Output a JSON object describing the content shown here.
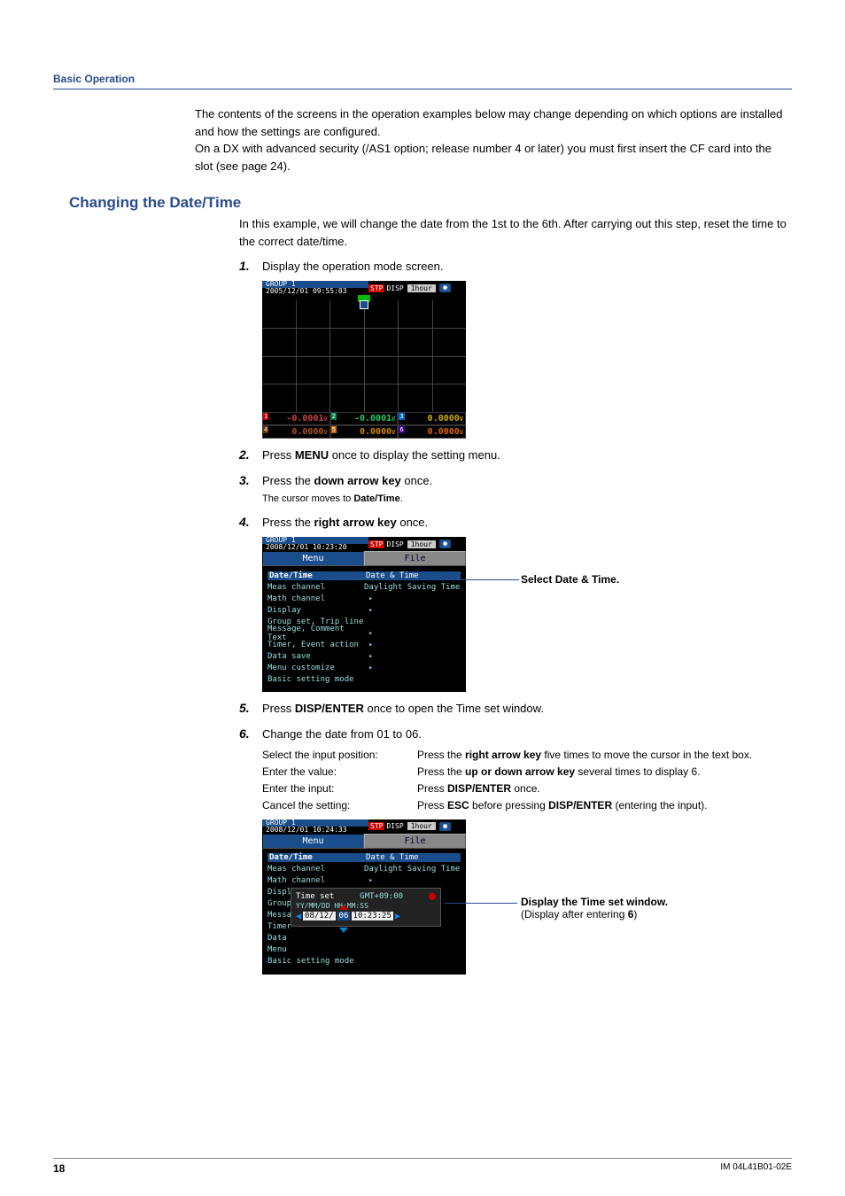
{
  "header": {
    "title": "Basic Operation"
  },
  "intro": {
    "p1": "The contents of the screens in the operation examples below may change depending on which options are installed and how the settings are configured.",
    "p2a": "On a DX with advanced security (/AS1 option; release number 4 or later) you must first insert the CF card into the slot (see page 24)."
  },
  "section": {
    "title": "Changing the Date/Time"
  },
  "lead": "In this example, we will change the date from the 1st to the 6th. After carrying out this step, reset the time to the correct date/time.",
  "steps": {
    "s1": {
      "n": "1.",
      "text": "Display the operation mode screen."
    },
    "s2": {
      "n": "2.",
      "pre": "Press ",
      "b": "MENU",
      "post": " once to display the setting menu."
    },
    "s3": {
      "n": "3.",
      "pre": "Press the ",
      "b": "down arrow key",
      "post": " once.",
      "note_pre": "The cursor moves to ",
      "note_b": "Date/Time",
      "note_post": "."
    },
    "s4": {
      "n": "4.",
      "pre": "Press the ",
      "b": "right arrow key",
      "post": " once."
    },
    "s5": {
      "n": "5.",
      "pre": "Press ",
      "b": "DISP/ENTER",
      "post": " once to open the Time set window."
    },
    "s6": {
      "n": "6.",
      "text": "Change the date from 01 to 06."
    }
  },
  "inputs": {
    "r1": {
      "label": "Select the input position:",
      "d1": "Press the ",
      "b": "right arrow key",
      "d2": " five times to move the cursor in the text box."
    },
    "r2": {
      "label": "Enter the value:",
      "d1": "Press the ",
      "b": "up or down arrow key",
      "d2": " several times to display 6."
    },
    "r3": {
      "label": "Enter the input:",
      "d1": "Press ",
      "b": "DISP/ENTER",
      "d2": " once."
    },
    "r4": {
      "label": "Cancel the setting:",
      "d1": "Press ",
      "b": "ESC",
      "d2": " before pressing ",
      "b2": "DISP/ENTER",
      "d3": " (entering the input)."
    }
  },
  "shot1": {
    "group": "GROUP 1",
    "datetime": "2005/12/01 09:55:03",
    "badge": "STP",
    "disp": "DISP",
    "span": "1hour",
    "cam": "◉",
    "r1": {
      "t": "1",
      "v": "-0.0001",
      "u": "V",
      "tbg": "#c00",
      "c": "#c44"
    },
    "r2": {
      "t": "2",
      "v": "-0.0001",
      "u": "V",
      "tbg": "#084",
      "c": "#2c6"
    },
    "r3": {
      "t": "3",
      "v": "0.0000",
      "u": "V",
      "tbg": "#06c",
      "c": "#ca0"
    },
    "r4": {
      "t": "4",
      "v": "0.0000",
      "u": "V",
      "tbg": "#630",
      "c": "#a52"
    },
    "r5": {
      "t": "5",
      "v": "0.0000",
      "u": "V",
      "tbg": "#c60",
      "c": "#c80"
    },
    "r6": {
      "t": "6",
      "v": "0.0000",
      "u": "V",
      "tbg": "#408",
      "c": "#d60"
    }
  },
  "shot2": {
    "group": "GROUP 1",
    "datetime": "2008/12/01 10:23:20",
    "badge": "STP",
    "disp": "DISP",
    "span": "1hour",
    "cam": "◉",
    "tab_menu": "Menu",
    "tab_file": "File",
    "items_left": [
      "Date/Time",
      "Meas channel",
      "Math channel",
      "Display",
      "Group set, Trip line",
      "Message, Comment Text",
      "Timer, Event action",
      "Data save",
      "Menu customize",
      "Basic setting mode"
    ],
    "items_right": [
      "Date & Time",
      "Daylight Saving Time"
    ]
  },
  "callout2": "Select Date & Time.",
  "shot3": {
    "group": "GROUP 1",
    "datetime": "2008/12/01 10:24:33",
    "badge": "STP",
    "disp": "DISP",
    "span": "1hour",
    "cam": "◉",
    "tab_menu": "Menu",
    "tab_file": "File",
    "items_left": [
      "Date/Time",
      "Meas channel",
      "Math channel",
      "Displ",
      "Group",
      "Messa",
      "Timer",
      "Data",
      "Menu",
      "Basic setting mode"
    ],
    "items_right": [
      "Date & Time",
      "Daylight Saving Time"
    ],
    "popup": {
      "title": "Time set",
      "gmt": "GMT+09:00",
      "fmt": "YY/MM/DD   HH:MM:SS",
      "val_pre": "08/12/",
      "cur": "06",
      "val_post": " 10:23:25"
    }
  },
  "callout3a": "Display the Time set window.",
  "callout3b": "(Display after entering ",
  "callout3c": "6",
  "callout3d": ")",
  "footer": {
    "page": "18",
    "doc": "IM 04L41B01-02E"
  }
}
